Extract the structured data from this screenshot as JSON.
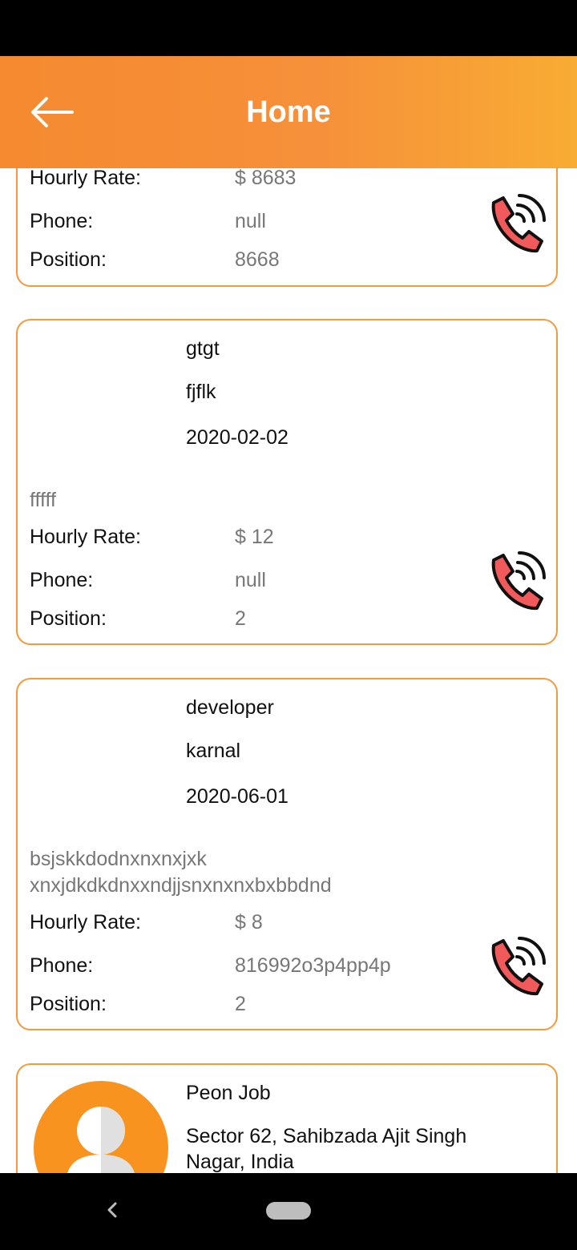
{
  "header": {
    "title": "Home"
  },
  "labels": {
    "hourly_rate": "Hourly Rate:",
    "phone": "Phone:",
    "position": "Position:"
  },
  "jobs": [
    {
      "hourly_rate": "$ 8683",
      "phone": "null",
      "position": "8668"
    },
    {
      "title": "gtgt",
      "location": "fjflk",
      "date": "2020-02-02",
      "description": "fffff",
      "hourly_rate": "$ 12",
      "phone": "null",
      "position": "2"
    },
    {
      "title": "developer",
      "location": "karnal",
      "date": "2020-06-01",
      "description_line1": "bsjskkdodnxnxnxjxk",
      "description_line2": "xnxjdkdkdnxxndjjsnxnxnxbxbbdnd",
      "hourly_rate": "$ 8",
      "phone": "816992o3p4pp4p",
      "position": "2"
    },
    {
      "title": "Peon Job",
      "location_line1": "Sector 62, Sahibzada Ajit Singh",
      "location_line2": "Nagar, India"
    }
  ],
  "icons": {
    "back": "arrow-left-icon",
    "call": "phone-call-icon",
    "avatar": "user-avatar-icon"
  },
  "colors": {
    "accent": "#f58a30",
    "accent_end": "#f8ac33",
    "phone_red": "#f05a5a",
    "avatar_orange": "#f7931e"
  }
}
